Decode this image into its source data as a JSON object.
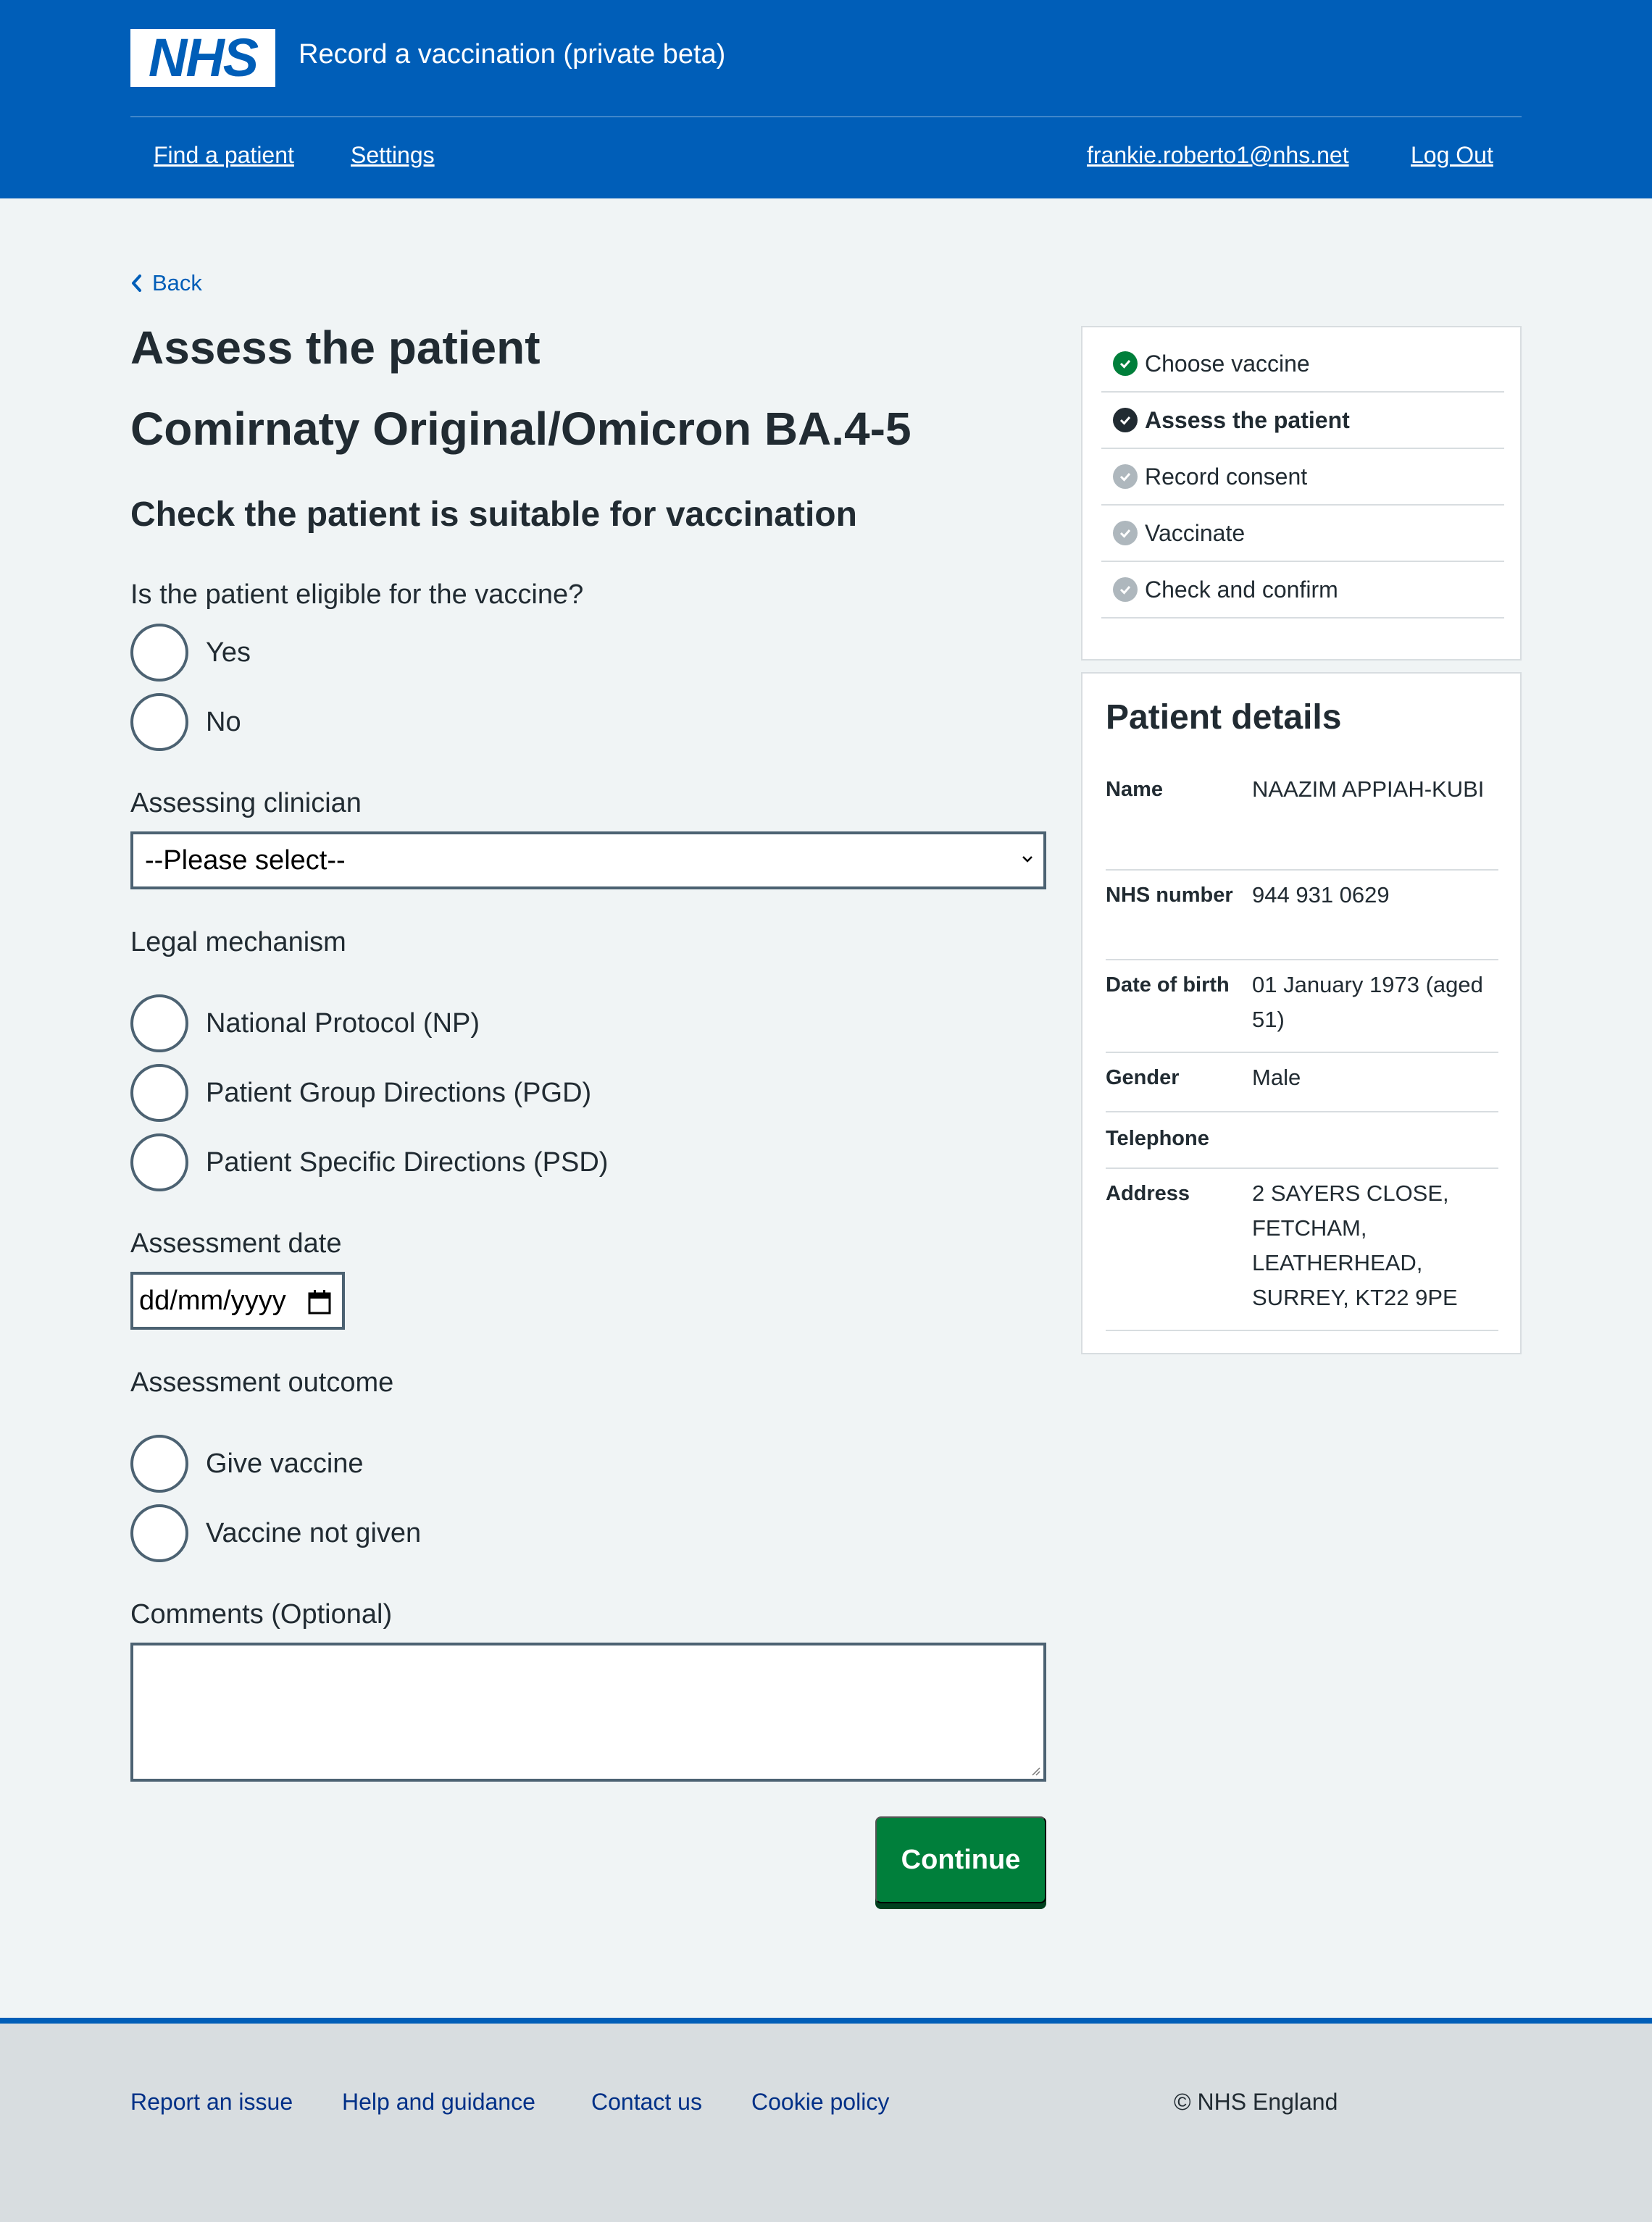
{
  "header": {
    "logo_text": "NHS",
    "service_name": "Record a vaccination (private beta)",
    "nav": {
      "find_patient": "Find a patient",
      "settings": "Settings"
    },
    "user_email": "frankie.roberto1@nhs.net",
    "logout": "Log Out"
  },
  "back": "Back",
  "page": {
    "title": "Assess the patient",
    "vaccine": "Comirnaty Original/Omicron BA.4-5",
    "section_heading": "Check the patient is suitable for vaccination"
  },
  "form": {
    "eligible": {
      "label": "Is the patient eligible for the vaccine?",
      "options": [
        "Yes",
        "No"
      ]
    },
    "clinician": {
      "label": "Assessing clinician",
      "selected": "--Please select--"
    },
    "legal": {
      "label": "Legal mechanism",
      "options": [
        "National Protocol (NP)",
        "Patient Group Directions (PGD)",
        "Patient Specific Directions (PSD)"
      ]
    },
    "assessment_date": {
      "label": "Assessment date",
      "placeholder": "dd/mm/yyyy"
    },
    "outcome": {
      "label": "Assessment outcome",
      "options": [
        "Give vaccine",
        "Vaccine not given"
      ]
    },
    "comments": {
      "label": "Comments (Optional)",
      "value": ""
    },
    "continue": "Continue"
  },
  "tasks": [
    {
      "label": "Choose vaccine",
      "status": "complete"
    },
    {
      "label": "Assess the patient",
      "status": "current"
    },
    {
      "label": "Record consent",
      "status": "pending"
    },
    {
      "label": "Vaccinate",
      "status": "pending"
    },
    {
      "label": "Check and confirm",
      "status": "pending"
    }
  ],
  "patient": {
    "title": "Patient details",
    "rows": [
      {
        "key": "Name",
        "value": "NAAZIM APPIAH-KUBI"
      },
      {
        "key": "NHS number",
        "value": "944 931 0629"
      },
      {
        "key": "Date of birth",
        "value": "01 January 1973 (aged 51)"
      },
      {
        "key": "Gender",
        "value": "Male"
      },
      {
        "key": "Telephone",
        "value": ""
      },
      {
        "key": "Address",
        "value": "2 SAYERS CLOSE, FETCHAM, LEATHERHEAD, SURREY, KT22 9PE"
      }
    ]
  },
  "footer": {
    "links": [
      "Report an issue",
      "Help and guidance",
      "Contact us",
      "Cookie policy"
    ],
    "copyright": "© NHS England"
  },
  "colors": {
    "brand_blue": "#005eb8",
    "page_background": "#f0f4f5",
    "button_green": "#007f3b",
    "text": "#212b32",
    "border": "#4c6272"
  }
}
